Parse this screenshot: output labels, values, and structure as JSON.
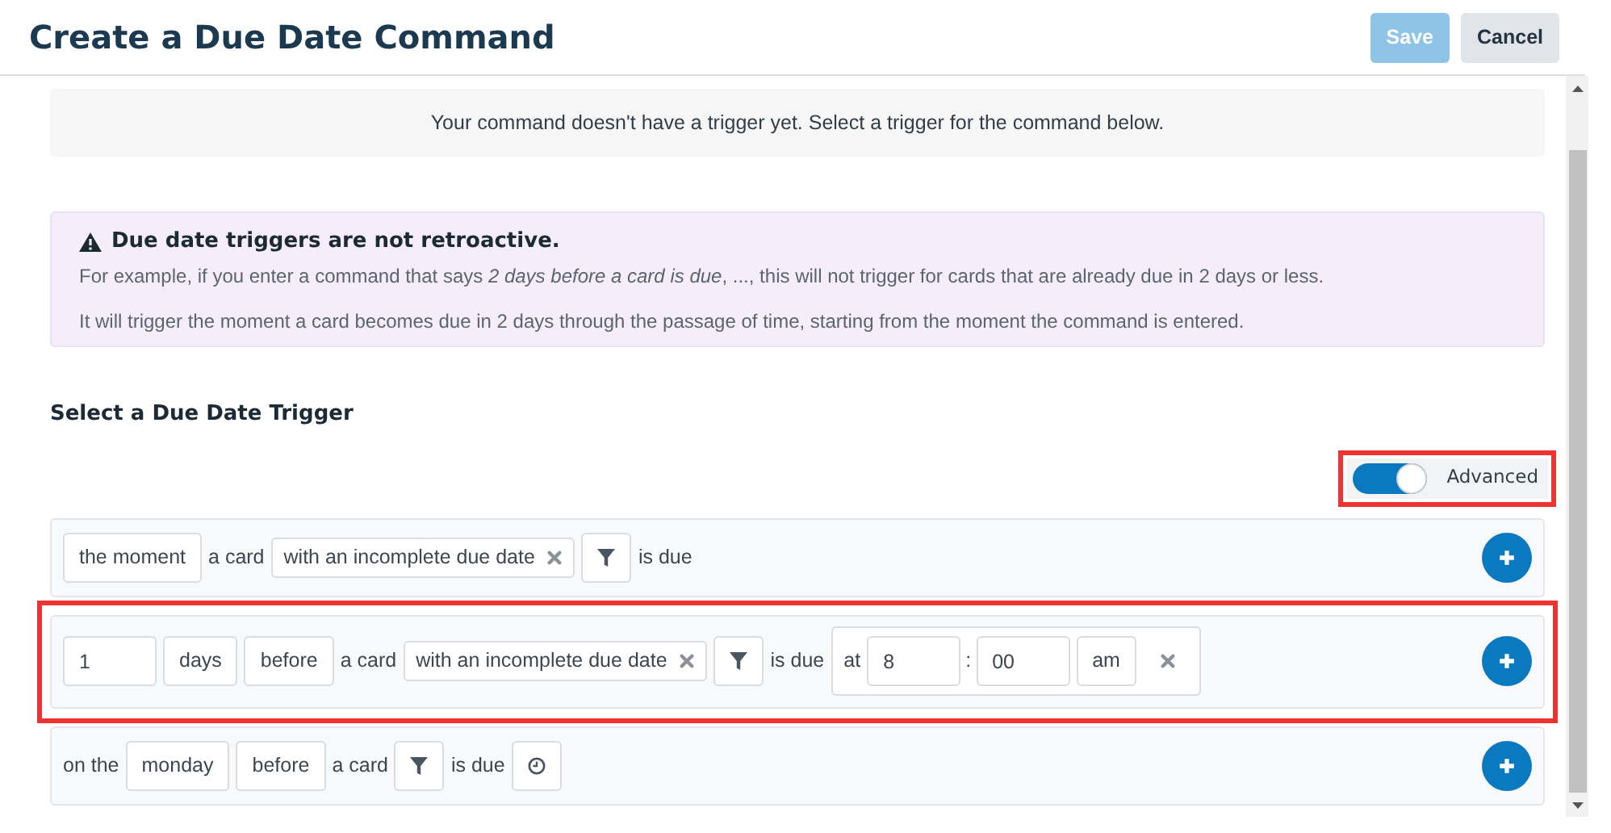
{
  "header": {
    "title": "Create a Due Date Command",
    "buttons": [
      {
        "label": "Save",
        "disabled": true
      },
      {
        "label": "Cancel",
        "disabled": false
      }
    ]
  },
  "notice": "Your command doesn't have a trigger yet. Select a trigger for the command below.",
  "alert": {
    "title": "Due date triggers are not retroactive.",
    "lines": [
      "For example, if you enter a command that says *2 days before a card is due*, ..., this will not trigger for cards that are already due in 2 days or less.",
      "It will trigger the moment a card becomes due in 2 days through the passage of time, starting from the moment the command is entered."
    ]
  },
  "section_title": "Select a Due Date Trigger",
  "advanced": {
    "label": "Advanced",
    "on": true,
    "highlighted": true
  },
  "triggers": [
    {
      "highlighted": false,
      "parts": [
        {
          "kind": "select",
          "text": "the moment"
        },
        {
          "kind": "text",
          "text": "a card"
        },
        {
          "kind": "chip",
          "text": "with an incomplete due date"
        },
        {
          "kind": "filter"
        },
        {
          "kind": "text",
          "text": "is due"
        }
      ]
    },
    {
      "highlighted": true,
      "parts": [
        {
          "kind": "input",
          "value": "1"
        },
        {
          "kind": "select",
          "text": "days"
        },
        {
          "kind": "select",
          "text": "before"
        },
        {
          "kind": "text",
          "text": "a card"
        },
        {
          "kind": "chip",
          "text": "with an incomplete due date"
        },
        {
          "kind": "filter"
        },
        {
          "kind": "text",
          "text": "is due"
        },
        {
          "kind": "time",
          "at": "at",
          "hour": "8",
          "separator": ":",
          "minute": "00",
          "ampm": "am"
        }
      ]
    },
    {
      "highlighted": false,
      "parts": [
        {
          "kind": "text",
          "text": "on the"
        },
        {
          "kind": "select",
          "text": "monday"
        },
        {
          "kind": "select",
          "text": "before"
        },
        {
          "kind": "text",
          "text": "a card"
        },
        {
          "kind": "filter"
        },
        {
          "kind": "text",
          "text": "is due"
        },
        {
          "kind": "clock"
        }
      ]
    }
  ]
}
